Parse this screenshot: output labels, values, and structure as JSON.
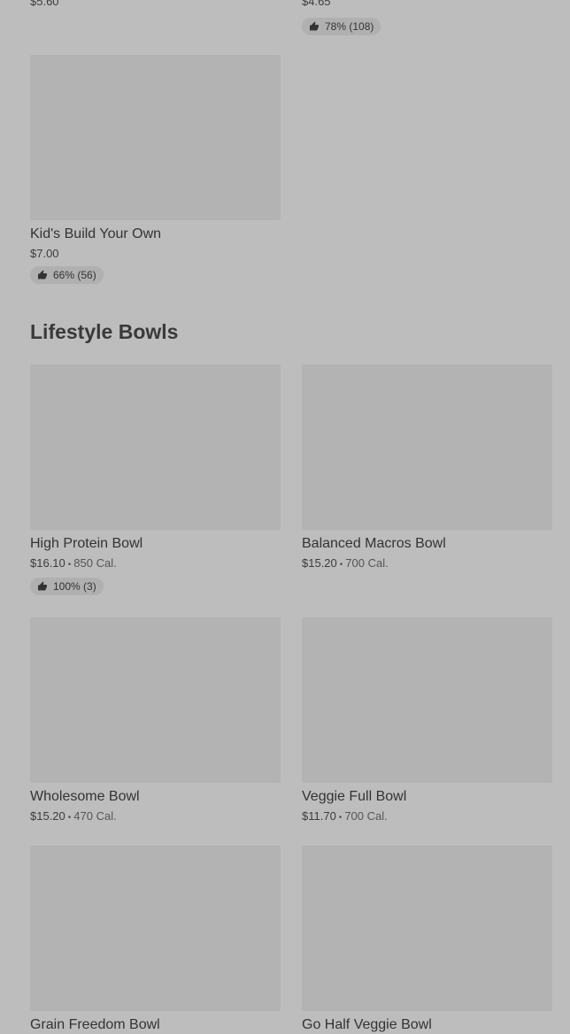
{
  "top_partial": {
    "left_price": "$5.60",
    "right_price": "$4.65",
    "right_rating": "78% (108)"
  },
  "kids_card": {
    "name": "Kid's Build Your Own",
    "price": "$7.00",
    "rating": "66% (56)"
  },
  "section": {
    "title": "Lifestyle Bowls"
  },
  "items": [
    {
      "name": "High Protein Bowl",
      "price": "$16.10",
      "calories": "850 Cal.",
      "rating": "100% (3)"
    },
    {
      "name": "Balanced Macros Bowl",
      "price": "$15.20",
      "calories": "700 Cal."
    },
    {
      "name": "Wholesome Bowl",
      "price": "$15.20",
      "calories": "470 Cal."
    },
    {
      "name": "Veggie Full Bowl",
      "price": "$11.70",
      "calories": "700 Cal."
    },
    {
      "name": "Grain Freedom Bowl"
    },
    {
      "name": "Go Half Veggie Bowl"
    }
  ],
  "separator": "•",
  "icons": {
    "rating": "thumbs-up-icon"
  }
}
